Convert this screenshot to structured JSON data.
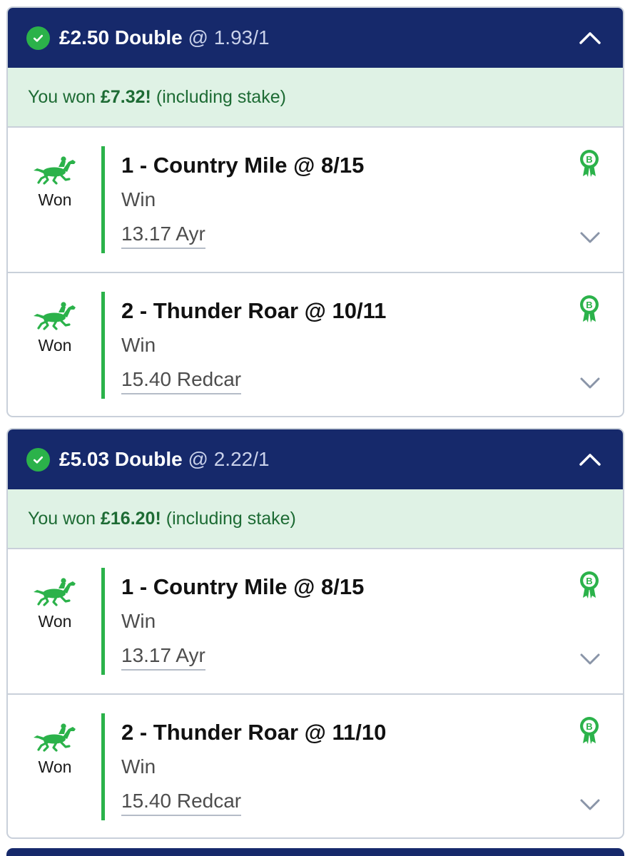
{
  "colors": {
    "header_bg": "#16296b",
    "success_green": "#2bb24a",
    "won_banner_bg": "#dff2e5",
    "won_text": "#1d6b34",
    "border": "#c9d0da"
  },
  "bets": [
    {
      "stake": "£2.50",
      "bet_type": "Double",
      "odds": "@ 1.93/1",
      "status_icon": "check-circle-icon",
      "toggle_icon": "chevron-up-icon",
      "won_prefix": "You won",
      "won_amount": "£7.32!",
      "won_suffix": "(including stake)",
      "selections": [
        {
          "title": "1 - Country Mile @ 8/15",
          "market": "Win",
          "race": "13.17 Ayr",
          "result": "Won",
          "icon": "horse-racing-icon",
          "badge_icon": "boost-badge-icon",
          "expand_icon": "chevron-down-icon"
        },
        {
          "title": "2 - Thunder Roar @ 10/11",
          "market": "Win",
          "race": "15.40 Redcar",
          "result": "Won",
          "icon": "horse-racing-icon",
          "badge_icon": "boost-badge-icon",
          "expand_icon": "chevron-down-icon"
        }
      ]
    },
    {
      "stake": "£5.03",
      "bet_type": "Double",
      "odds": "@ 2.22/1",
      "status_icon": "check-circle-icon",
      "toggle_icon": "chevron-up-icon",
      "won_prefix": "You won",
      "won_amount": "£16.20!",
      "won_suffix": "(including stake)",
      "selections": [
        {
          "title": "1 - Country Mile @ 8/15",
          "market": "Win",
          "race": "13.17 Ayr",
          "result": "Won",
          "icon": "horse-racing-icon",
          "badge_icon": "boost-badge-icon",
          "expand_icon": "chevron-down-icon"
        },
        {
          "title": "2 - Thunder Roar @ 11/10",
          "market": "Win",
          "race": "15.40 Redcar",
          "result": "Won",
          "icon": "horse-racing-icon",
          "badge_icon": "boost-badge-icon",
          "expand_icon": "chevron-down-icon"
        }
      ]
    }
  ]
}
